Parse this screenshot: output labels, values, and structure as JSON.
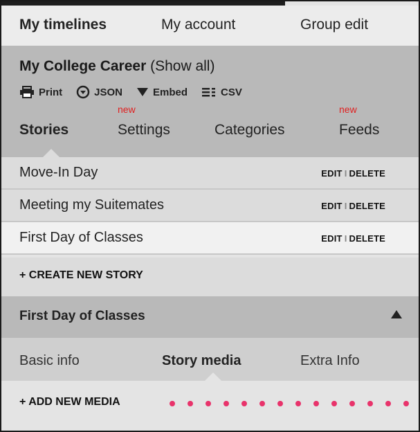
{
  "top_nav": {
    "tabs": [
      {
        "label": "My timelines",
        "active": true
      },
      {
        "label": "My account",
        "active": false
      },
      {
        "label": "Group edit",
        "active": false
      }
    ]
  },
  "timeline": {
    "title": "My College Career",
    "show_all": "(Show all)",
    "tools": [
      {
        "label": "Print",
        "icon": "printer-icon"
      },
      {
        "label": "JSON",
        "icon": "download-circle-icon"
      },
      {
        "label": "Embed",
        "icon": "triangle-down-icon"
      },
      {
        "label": "CSV",
        "icon": "list-icon"
      }
    ],
    "tabs": [
      {
        "label": "Stories",
        "active": true,
        "badge": ""
      },
      {
        "label": "Settings",
        "active": false,
        "badge": "new"
      },
      {
        "label": "Categories",
        "active": false,
        "badge": ""
      },
      {
        "label": "Feeds",
        "active": false,
        "badge": "new"
      }
    ]
  },
  "stories": {
    "items": [
      {
        "title": "Move-In Day",
        "edit": "EDIT",
        "separator": "I",
        "delete": "DELETE",
        "selected": false
      },
      {
        "title": "Meeting my Suitemates",
        "edit": "EDIT",
        "separator": "I",
        "delete": "DELETE",
        "selected": false
      },
      {
        "title": "First Day of Classes",
        "edit": "EDIT",
        "separator": "I",
        "delete": "DELETE",
        "selected": true
      }
    ],
    "create_label": "+ CREATE NEW STORY"
  },
  "story_editor": {
    "title": "First Day of Classes",
    "tabs": [
      {
        "label": "Basic info",
        "active": false
      },
      {
        "label": "Story media",
        "active": true
      },
      {
        "label": "Extra Info",
        "active": false
      }
    ],
    "add_media_label": "+ ADD NEW MEDIA"
  },
  "colors": {
    "new_badge": "#e02020",
    "annotation_dots": "#e8336b"
  }
}
